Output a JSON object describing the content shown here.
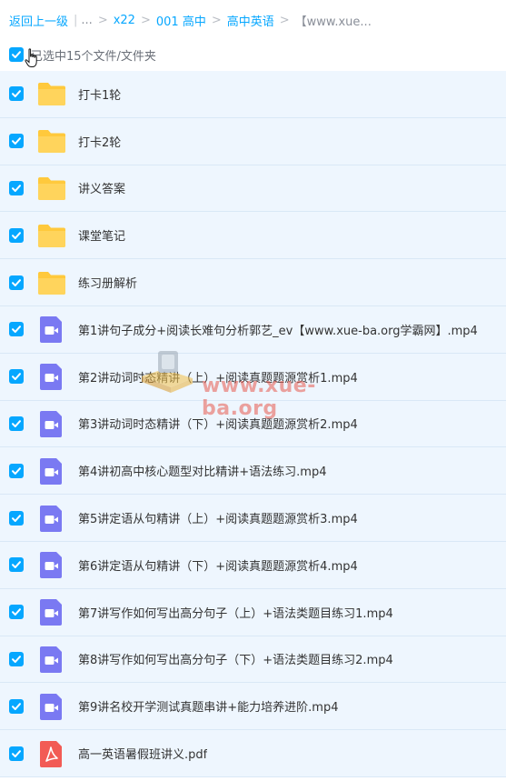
{
  "breadcrumb": {
    "back_label": "返回上一级",
    "ellipsis": "...",
    "items": [
      "x22",
      "001 高中",
      "高中英语",
      "【www.xue..."
    ]
  },
  "selection": {
    "label": "已选中15个文件/文件夹"
  },
  "files": [
    {
      "name": "打卡1轮",
      "type": "folder"
    },
    {
      "name": "打卡2轮",
      "type": "folder"
    },
    {
      "name": "讲义答案",
      "type": "folder"
    },
    {
      "name": "课堂笔记",
      "type": "folder"
    },
    {
      "name": "练习册解析",
      "type": "folder"
    },
    {
      "name": "第1讲句子成分+阅读长难句分析郭艺_ev【www.xue-ba.org学霸网】.mp4",
      "type": "video"
    },
    {
      "name": "第2讲动词时态精讲（上）+阅读真题题源赏析1.mp4",
      "type": "video"
    },
    {
      "name": "第3讲动词时态精讲（下）+阅读真题题源赏析2.mp4",
      "type": "video"
    },
    {
      "name": "第4讲初高中核心题型对比精讲+语法练习.mp4",
      "type": "video"
    },
    {
      "name": "第5讲定语从句精讲（上）+阅读真题题源赏析3.mp4",
      "type": "video"
    },
    {
      "name": "第6讲定语从句精讲（下）+阅读真题题源赏析4.mp4",
      "type": "video"
    },
    {
      "name": "第7讲写作如何写出高分句子（上）+语法类题目练习1.mp4",
      "type": "video"
    },
    {
      "name": "第8讲写作如何写出高分句子（下）+语法类题目练习2.mp4",
      "type": "video"
    },
    {
      "name": "第9讲名校开学测试真题串讲+能力培养进阶.mp4",
      "type": "video"
    },
    {
      "name": "高一英语暑假班讲义.pdf",
      "type": "pdf"
    }
  ],
  "watermark": {
    "text": "www.xue-ba.org"
  },
  "colors": {
    "accent": "#06a7ff",
    "folder": "#ffc93c",
    "video": "#7a79f2",
    "pdf": "#f25b55",
    "row_bg": "#eef6fe"
  }
}
